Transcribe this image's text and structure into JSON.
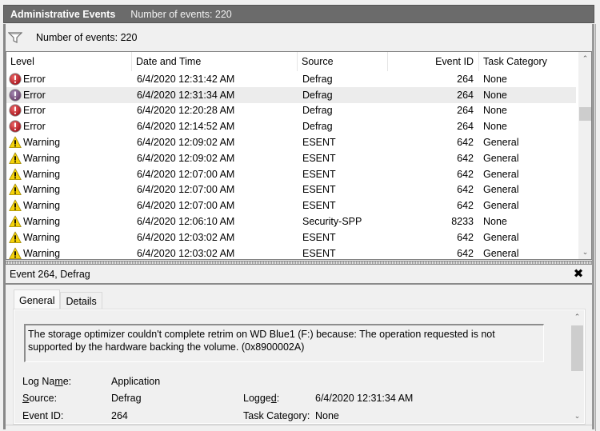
{
  "titlebar": {
    "title": "Administrative Events",
    "subtitle": "Number of events: 220"
  },
  "filterbar": {
    "icon": "filter-icon",
    "count_label": "Number of events: 220"
  },
  "grid": {
    "columns": [
      "Level",
      "Date and Time",
      "Source",
      "Event ID",
      "Task Category"
    ],
    "selected_row_index": 1,
    "rows": [
      {
        "level": "Error",
        "icon": "error-icon",
        "datetime": "6/4/2020 12:31:42 AM",
        "source": "Defrag",
        "event_id": "264",
        "task_category": "None"
      },
      {
        "level": "Error",
        "icon": "error-icon",
        "datetime": "6/4/2020 12:31:34 AM",
        "source": "Defrag",
        "event_id": "264",
        "task_category": "None"
      },
      {
        "level": "Error",
        "icon": "error-icon",
        "datetime": "6/4/2020 12:20:28 AM",
        "source": "Defrag",
        "event_id": "264",
        "task_category": "None"
      },
      {
        "level": "Error",
        "icon": "error-icon",
        "datetime": "6/4/2020 12:14:52 AM",
        "source": "Defrag",
        "event_id": "264",
        "task_category": "None"
      },
      {
        "level": "Warning",
        "icon": "warning-icon",
        "datetime": "6/4/2020 12:09:02 AM",
        "source": "ESENT",
        "event_id": "642",
        "task_category": "General"
      },
      {
        "level": "Warning",
        "icon": "warning-icon",
        "datetime": "6/4/2020 12:09:02 AM",
        "source": "ESENT",
        "event_id": "642",
        "task_category": "General"
      },
      {
        "level": "Warning",
        "icon": "warning-icon",
        "datetime": "6/4/2020 12:07:00 AM",
        "source": "ESENT",
        "event_id": "642",
        "task_category": "General"
      },
      {
        "level": "Warning",
        "icon": "warning-icon",
        "datetime": "6/4/2020 12:07:00 AM",
        "source": "ESENT",
        "event_id": "642",
        "task_category": "General"
      },
      {
        "level": "Warning",
        "icon": "warning-icon",
        "datetime": "6/4/2020 12:07:00 AM",
        "source": "ESENT",
        "event_id": "642",
        "task_category": "General"
      },
      {
        "level": "Warning",
        "icon": "warning-icon",
        "datetime": "6/4/2020 12:06:10 AM",
        "source": "Security-SPP",
        "event_id": "8233",
        "task_category": "None"
      },
      {
        "level": "Warning",
        "icon": "warning-icon",
        "datetime": "6/4/2020 12:03:02 AM",
        "source": "ESENT",
        "event_id": "642",
        "task_category": "General"
      },
      {
        "level": "Warning",
        "icon": "warning-icon",
        "datetime": "6/4/2020 12:03:02 AM",
        "source": "ESENT",
        "event_id": "642",
        "task_category": "General"
      }
    ]
  },
  "detail": {
    "title": "Event 264, Defrag",
    "close_icon": "close-icon",
    "tabs": [
      {
        "label": "General",
        "active": true
      },
      {
        "label": "Details",
        "active": false
      }
    ],
    "description": "The storage optimizer couldn't complete retrim on WD Blue1 (F:) because: The operation requested is not supported by the hardware backing the volume. (0x8900002A)",
    "properties": {
      "log_name_label": "Log Name:",
      "log_name_value": "Application",
      "source_label": "Source:",
      "source_value": "Defrag",
      "logged_label": "Logged:",
      "logged_value": "6/4/2020 12:31:34 AM",
      "event_id_label": "Event ID:",
      "event_id_value": "264",
      "task_category_label": "Task Category:",
      "task_category_value": "None"
    }
  },
  "colors": {
    "titlebar_bg": "#6b6b6b",
    "selected_row": "#ececec",
    "error_red": "#c8202a",
    "warning_yellow": "#f5d20a",
    "scroll_thumb": "#cdcdcd"
  }
}
